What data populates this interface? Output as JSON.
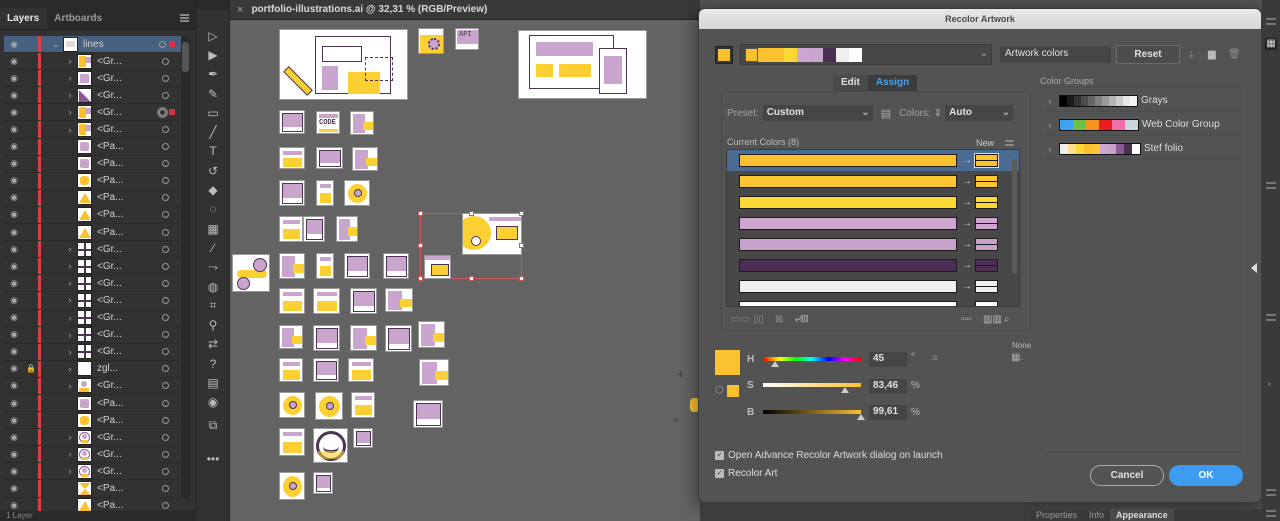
{
  "layers_panel": {
    "tabs": [
      {
        "label": "Layers",
        "active": true
      },
      {
        "label": "Artboards",
        "active": false
      }
    ],
    "rows": [
      {
        "name": "lines",
        "expanded": true,
        "selected": true,
        "thumb": "artboard",
        "has_caret": true,
        "selection_square": true,
        "lock": false
      },
      {
        "name": "<Gr...",
        "has_caret": true,
        "thumb": "yellow-purple"
      },
      {
        "name": "<Gr...",
        "has_caret": true,
        "thumb": "purple-grid"
      },
      {
        "name": "<Gr...",
        "has_caret": true,
        "thumb": "purple-triangle"
      },
      {
        "name": "<Gr...",
        "has_caret": true,
        "thumb": "yellow-purple",
        "selection_square": true,
        "targeted": true
      },
      {
        "name": "<Gr...",
        "has_caret": true,
        "thumb": "yellow-purple"
      },
      {
        "name": "<Pa...",
        "has_caret": false,
        "thumb": "purple-puzzle"
      },
      {
        "name": "<Pa...",
        "has_caret": false,
        "thumb": "purple-puzzle"
      },
      {
        "name": "<Pa...",
        "has_caret": false,
        "thumb": "yellow-puzzle"
      },
      {
        "name": "<Pa...",
        "has_caret": false,
        "thumb": "yellow-triangle"
      },
      {
        "name": "<Pa...",
        "has_caret": false,
        "thumb": "yellow-triangle"
      },
      {
        "name": "<Pa...",
        "has_caret": false,
        "thumb": "yellow-triangle"
      },
      {
        "name": "<Gr...",
        "has_caret": true,
        "thumb": "grid"
      },
      {
        "name": "<Gr...",
        "has_caret": true,
        "thumb": "grid"
      },
      {
        "name": "<Gr...",
        "has_caret": true,
        "thumb": "grid"
      },
      {
        "name": "<Gr...",
        "has_caret": true,
        "thumb": "grid"
      },
      {
        "name": "<Gr...",
        "has_caret": true,
        "thumb": "grid"
      },
      {
        "name": "<Gr...",
        "has_caret": true,
        "thumb": "grid"
      },
      {
        "name": "<Gr...",
        "has_caret": true,
        "thumb": "grid"
      },
      {
        "name": "zgl...",
        "has_caret": true,
        "thumb": "white",
        "lock": true
      },
      {
        "name": "<Gr...",
        "has_caret": true,
        "thumb": "person"
      },
      {
        "name": "<Pa...",
        "has_caret": false,
        "thumb": "purple-puzzle"
      },
      {
        "name": "<Pa...",
        "has_caret": false,
        "thumb": "yellow-puzzle"
      },
      {
        "name": "<Gr...",
        "has_caret": true,
        "thumb": "person-circle"
      },
      {
        "name": "<Gr...",
        "has_caret": true,
        "thumb": "person-circle"
      },
      {
        "name": "<Gr...",
        "has_caret": true,
        "thumb": "person-circle"
      },
      {
        "name": "<Pa...",
        "has_caret": false,
        "thumb": "yellow-hourglass"
      },
      {
        "name": "<Pa...",
        "has_caret": false,
        "thumb": "yellow-triangle"
      }
    ],
    "footer_label": "1 Layer"
  },
  "toolbar": {
    "tools": [
      {
        "name": "direct-selection-tool",
        "glyph": "▷"
      },
      {
        "name": "selection-tool",
        "glyph": "▶"
      },
      {
        "name": "pen-tool",
        "glyph": "✒"
      },
      {
        "name": "curvature-tool",
        "glyph": "✎"
      },
      {
        "name": "rectangle-tool",
        "glyph": "▭"
      },
      {
        "name": "paintbrush-tool",
        "glyph": "╱"
      },
      {
        "name": "type-tool",
        "glyph": "T"
      },
      {
        "name": "rotate-tool",
        "glyph": "↺"
      },
      {
        "name": "eraser-tool",
        "glyph": "◆"
      },
      {
        "name": "lasso-tool",
        "glyph": "◌"
      },
      {
        "name": "gradient-tool",
        "glyph": "▦"
      },
      {
        "name": "eyedropper-tool",
        "glyph": "⁄"
      },
      {
        "name": "puppet-warp-tool",
        "glyph": "⤳"
      },
      {
        "name": "shape-builder-tool",
        "glyph": "◍"
      },
      {
        "name": "artboard-tool",
        "glyph": "⌗"
      },
      {
        "name": "zoom-tool",
        "glyph": "⚲"
      },
      {
        "name": "swap-fill-stroke",
        "glyph": "⇄"
      },
      {
        "name": "fill-stroke",
        "glyph": "?"
      },
      {
        "name": "color-modes",
        "glyph": "▤"
      },
      {
        "name": "draw-modes",
        "glyph": "◉"
      },
      {
        "name": "screen-mode",
        "glyph": "⧉"
      },
      {
        "name": "more-tools",
        "glyph": "•••"
      }
    ]
  },
  "document": {
    "tab_title": "portfolio-illustrations.ai @ 32,31 % (RGB/Preview)",
    "close_glyph": "×"
  },
  "dialog": {
    "title": "Recolor Artwork",
    "harmony_colors": [
      "#fcc12e",
      "#fcc12e",
      "#fcc12e",
      "#fdd835",
      "#cda7d0",
      "#c9a4cd",
      "#4b2f52",
      "#efefef",
      "#ffffff"
    ],
    "color_group_name": "Artwork colors",
    "reset_label": "Reset",
    "tabs": {
      "edit": "Edit",
      "assign": "Assign",
      "active": "Assign"
    },
    "preset_label": "Preset:",
    "preset_value": "Custom",
    "colors_label": "Colors:",
    "colors_value": "Auto",
    "current_colors_label": "Current Colors (8)",
    "new_label": "New",
    "current_colors": [
      {
        "current": "#fcc12e",
        "new": "#fcc12e",
        "selected": true
      },
      {
        "current": "#fcc634",
        "new": "#fcc634"
      },
      {
        "current": "#fdd835",
        "new": "#fdd835"
      },
      {
        "current": "#cda7d0",
        "new": "#cda7d0"
      },
      {
        "current": "#c9a2cb",
        "new": "#c9a2cb"
      },
      {
        "current": "#4b2f52",
        "new": "#4b2f52"
      },
      {
        "current": "#efefef",
        "new": "#efefef"
      },
      {
        "current": "#ffffff",
        "new": "#ffffff"
      }
    ],
    "hsb": {
      "h_label": "H",
      "h_value": "45",
      "h_unit": "°",
      "h_fraction": 0.125,
      "s_label": "S",
      "s_value": "83,46",
      "s_unit": "%",
      "s_fraction": 0.8346,
      "b_label": "B",
      "b_value": "99,61",
      "b_unit": "%",
      "b_fraction": 0.9961
    },
    "selected_color": "#fcc12e",
    "none_label": "None",
    "color_groups_label": "Color Groups",
    "color_groups": [
      {
        "name": "Grays",
        "swatches": [
          "#000000",
          "#1a1a1a",
          "#333333",
          "#4d4d4d",
          "#666666",
          "#808080",
          "#999999",
          "#b3b3b3",
          "#cccccc",
          "#e6e6e6",
          "#f2f2f2"
        ]
      },
      {
        "name": "Web Color Group",
        "swatches": [
          "#3ea2ee",
          "#6cc24a",
          "#f7931e",
          "#ed1c24",
          "#f26ea5",
          "#c8d6df"
        ]
      },
      {
        "name": "Stef folio",
        "swatches": [
          "#efefef",
          "#fde08a",
          "#fdd835",
          "#fcc12e",
          "#fcc634",
          "#cda7d0",
          "#c9a2cb",
          "#8b5a94",
          "#4b2f52",
          "#ffffff"
        ]
      }
    ],
    "checkboxes": [
      {
        "label": "Open Advance Recolor Artwork dialog on launch",
        "checked": true
      },
      {
        "label": "Recolor Art",
        "checked": true
      }
    ],
    "cancel_label": "Cancel",
    "ok_label": "OK"
  },
  "right_panel": {
    "tabs": [
      {
        "label": "Properties",
        "active": false
      },
      {
        "label": "Info",
        "active": false
      },
      {
        "label": "Appearance",
        "active": true
      }
    ]
  },
  "colors": {
    "yellow": "#fcc12e",
    "purple": "#c9a4cd",
    "dark_purple": "#4b2f52",
    "accent_blue": "#3d9bf0",
    "layer_color": "#d8414a"
  }
}
